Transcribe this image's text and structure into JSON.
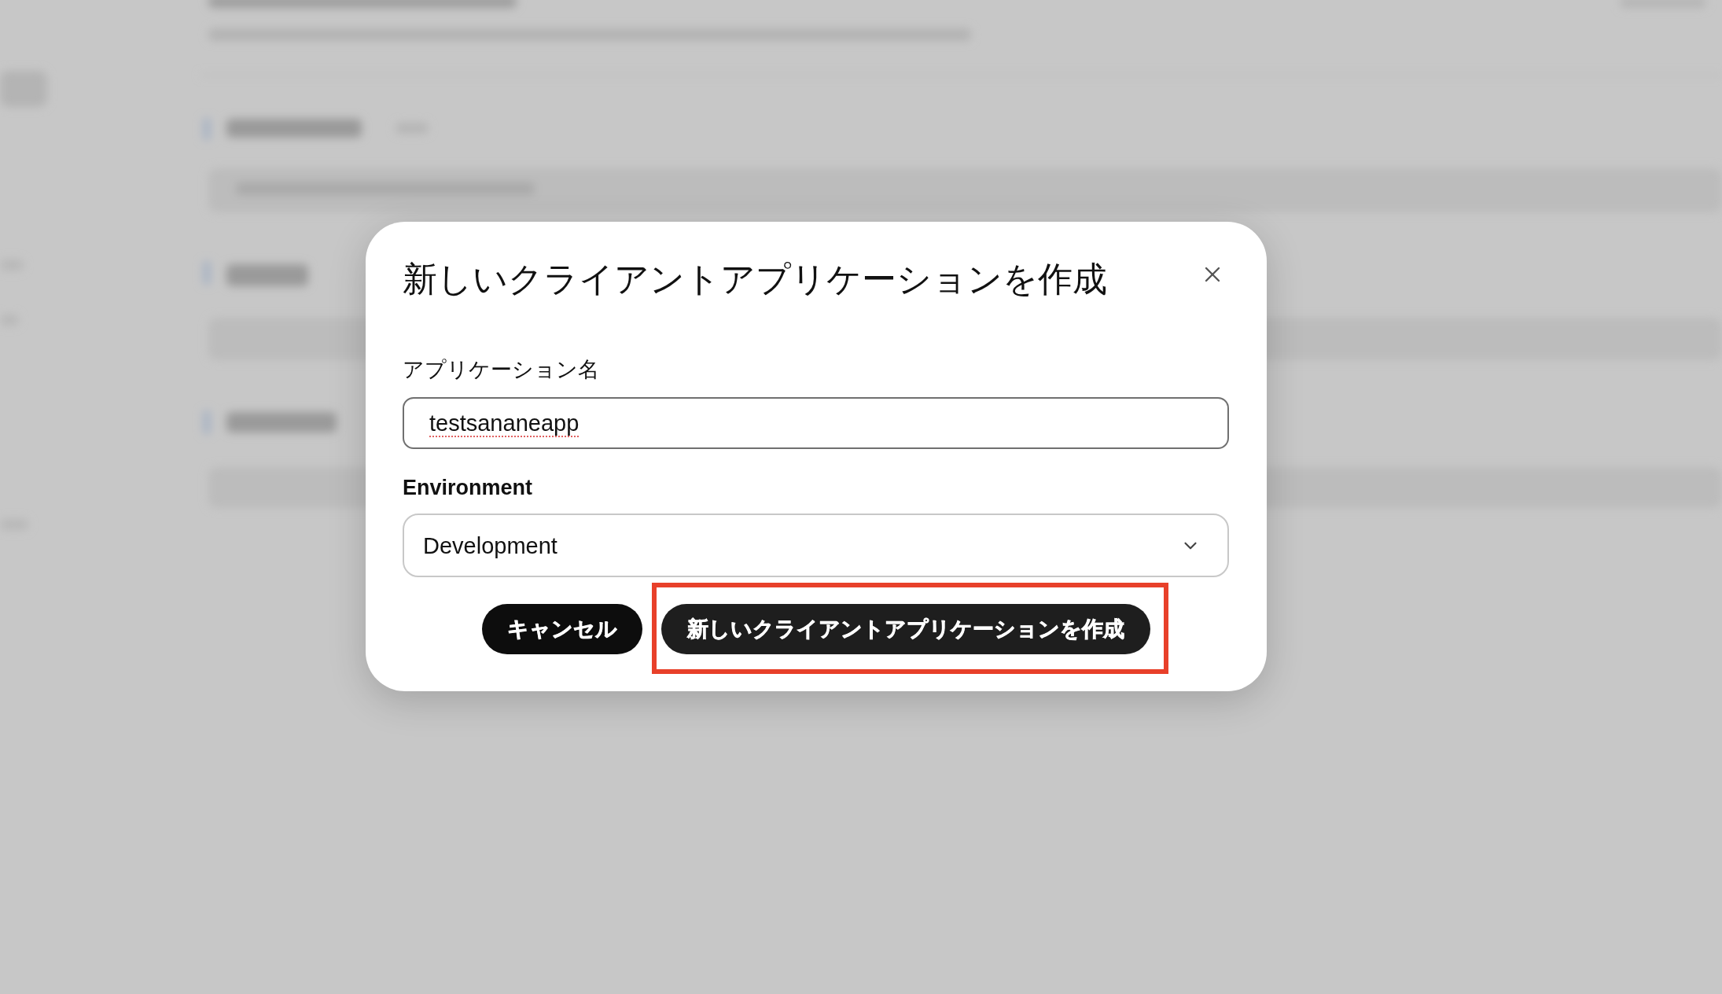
{
  "dialog": {
    "title": "新しいクライアントアプリケーションを作成",
    "fields": [
      {
        "kind": "text",
        "label": "アプリケーション名",
        "value": "testsananeapp",
        "focused": true,
        "spellcheck_flagged": true
      },
      {
        "kind": "select",
        "label": "Environment",
        "value": "Development"
      }
    ],
    "buttons": [
      {
        "kind": "cancel",
        "label": "キャンセル",
        "highlighted": false
      },
      {
        "kind": "submit",
        "label": "新しいクライアントアプリケーションを作成",
        "highlighted": true
      }
    ]
  }
}
